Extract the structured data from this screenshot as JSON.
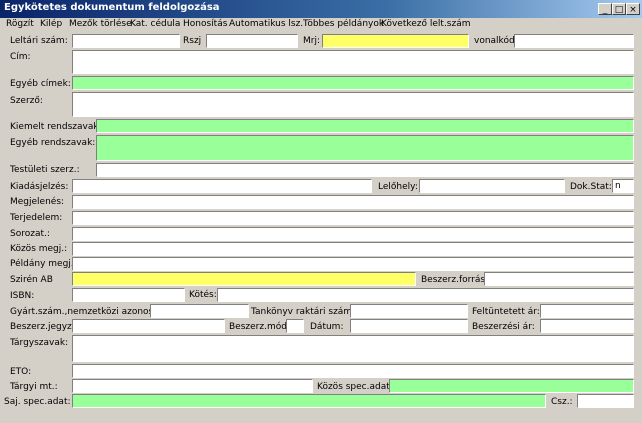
{
  "window": {
    "title": "Egykötetes dokumentum feldolgozása",
    "minimize": "_",
    "maximize": "□",
    "close": "×"
  },
  "menu": [
    "Rögzít",
    "Kilép",
    "Mezők törlése",
    "Kat. cédula",
    "Honosítás",
    "Automatikus lsz.",
    "Többes példányok",
    "Következő lelt.szám"
  ],
  "labels": {
    "leltari_szam": "Leltári szám:",
    "rszj": "Rszj",
    "mrj": "Mrj:",
    "vonalkod": "vonalkód:",
    "cim": "Cím:",
    "egyeb_cimek": "Egyéb címek:",
    "szerzo": "Szerző:",
    "kiemelt_rendszavak": "Kiemelt rendszavak:",
    "egyeb_rendszavak": "Egyéb rendszavak:",
    "testuleti_szerz": "Testületi szerz.:",
    "kiadasjelzes": "Kiadásjelzés:",
    "lelohely": "Lelőhely:",
    "dok_stat": "Dok.Stat:",
    "megjelenes": "Megjelenés:",
    "terjedelem": "Terjedelem:",
    "sorozat": "Sorozat.:",
    "kozos_megj": "Közös megj.:",
    "peldany_megj": "Példány megj.:",
    "sziren_ab": "Szirén AB",
    "beszerz_forras": "Beszerz.forrás",
    "isbn": "ISBN:",
    "kotes": "Kötés:",
    "gyart_szam": "Gyárt.szám.,nemzetközi azonosító:",
    "tankonyv_raktari_szama": "Tankönyv raktári száma:",
    "feltuntetett_ar": "Feltüntetett ár:",
    "beszerz_jegyz": "Beszerz.jegyz.:",
    "beszerz_mod": "Beszerz.mód.:",
    "datum": "Dátum:",
    "beszerzesi_ar": "Beszerzési ár:",
    "targyszavak": "Tárgyszavak:",
    "eto": "ETO:",
    "targyi_mt": "Tárgyi mt.:",
    "kozos_spec_adat": "Közös spec.adat:",
    "saj_spec_adat": "Saj. spec.adat:",
    "csz": "Csz.:"
  },
  "values": {
    "dok_stat": "n"
  }
}
